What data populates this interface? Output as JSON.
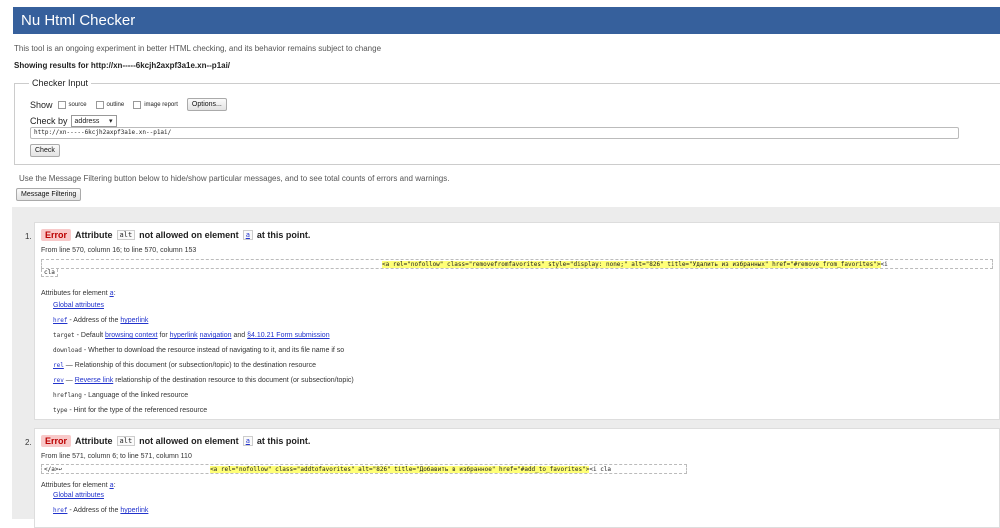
{
  "header": {
    "title": "Nu Html Checker"
  },
  "intro": "This tool is an ongoing experiment in better HTML checking, and its behavior remains subject to change",
  "showing": "Showing results for http://xn-----6kcjh2axpf3a1e.xn--p1ai/",
  "checker": {
    "legend": "Checker Input",
    "show_label": "Show",
    "options": [
      "source",
      "outline",
      "image report"
    ],
    "options_button": "Options...",
    "checkby_label": "Check by",
    "checkby_value": "address",
    "url_value": "http://xn-----6kcjh2axpf3a1e.xn--p1ai/",
    "check_button": "Check"
  },
  "filter": {
    "info": "Use the Message Filtering button below to hide/show particular messages, and to see total counts of errors and warnings.",
    "button": "Message Filtering"
  },
  "messages": [
    {
      "number": "1.",
      "type": "Error",
      "pre": "Attribute",
      "attr": "alt",
      "mid": "not allowed on element",
      "element": "a",
      "post": "at this point.",
      "location": "From line 570, column 16; to line 570, column 153",
      "extract_before": "",
      "extract_highlight": "<a rel=\"nofollow\" class=\"removefromfavorites\" style=\"display: none;\" alt=\"826\" title=\"Удалить из избранных\" href=\"#remove_from_favorites\">",
      "extract_after": "<i",
      "extract_cont": "cla",
      "attrs_title": "Attributes for element",
      "attrs_element": "a",
      "attributes": [
        {
          "name": "Global attributes",
          "desc": ""
        },
        {
          "name": "href",
          "desc": " - Address of the ",
          "link": "hyperlink"
        },
        {
          "name": "target",
          "desc": " - Default ",
          "link": "browsing context",
          "desc2": " for ",
          "link2": "hyperlink",
          "link3": "navigation",
          "desc3": " and ",
          "link4": "§4.10.21 Form submission"
        },
        {
          "name": "download",
          "desc": " - Whether to download the resource instead of navigating to it, and its file name if so"
        },
        {
          "name": "rel",
          "desc": " — Relationship of this document (or subsection/topic) to the destination resource"
        },
        {
          "name": "rev",
          "desc": " — ",
          "link": "Reverse link",
          "desc2": " relationship of the destination resource to this document (or subsection/topic)"
        },
        {
          "name": "hreflang",
          "desc": " - Language of the linked resource"
        },
        {
          "name": "type",
          "desc": " - Hint for the type of the referenced resource"
        }
      ]
    },
    {
      "number": "2.",
      "type": "Error",
      "pre": "Attribute",
      "attr": "alt",
      "mid": "not allowed on element",
      "element": "a",
      "post": "at this point.",
      "location": "From line 571, column 6; to line 571, column 110",
      "extract_before": "</a>↩",
      "extract_highlight": "<a rel=\"nofollow\" class=\"addtofavorites\" alt=\"826\" title=\"Добавить в избранное\" href=\"#add_to_favorites\">",
      "extract_after": "<i cla",
      "attrs_title": "Attributes for element",
      "attrs_element": "a",
      "attributes": [
        {
          "name": "Global attributes",
          "desc": ""
        },
        {
          "name": "href",
          "desc": " - Address of the ",
          "link": "hyperlink"
        }
      ]
    }
  ]
}
